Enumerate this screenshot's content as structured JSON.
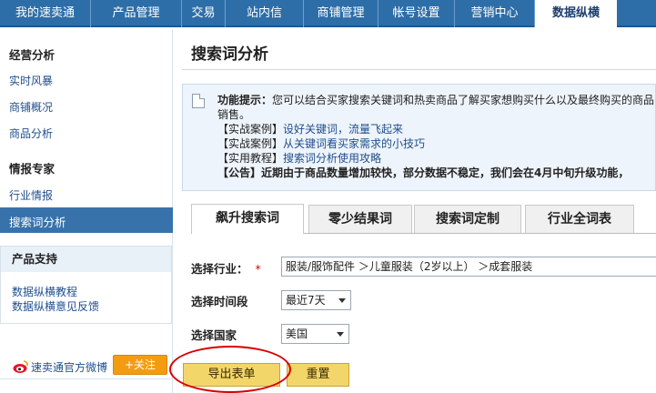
{
  "topnav": {
    "tabs": [
      "我的速卖通",
      "产品管理",
      "交易",
      "站内信",
      "商铺管理",
      "帐号设置",
      "营销中心",
      "数据纵横"
    ],
    "active_index": 7
  },
  "sidebar": {
    "section1_title": "经营分析",
    "section1_items": [
      "实时风暴",
      "商铺概况",
      "商品分析"
    ],
    "section2_title": "情报专家",
    "section2_items": [
      "行业情报",
      "搜索词分析"
    ],
    "active_item": "搜索词分析",
    "support": {
      "title": "产品支持",
      "links": [
        "数据纵横教程",
        "数据纵横意见反馈"
      ]
    },
    "weibo_label": "速卖通官方微博",
    "follow_label": "+关注"
  },
  "main": {
    "page_title": "搜索词分析",
    "notice": {
      "lead": "功能提示：",
      "text": "您可以结合买家搜索关键词和热卖商品了解买家想购买什么以及最终购买的商品",
      "text_cont": "销售。",
      "links": [
        {
          "prefix": "【实战案例】",
          "text": "设好关键词，流量飞起来"
        },
        {
          "prefix": "【实战案例】",
          "text": "从关键词看买家需求的小技巧"
        },
        {
          "prefix": "【实用教程】",
          "text": "搜索词分析使用攻略"
        }
      ],
      "announcement": "【公告】近期由于商品数量增加较快，部分数据不稳定，我们会在4月中旬升级功能，"
    },
    "tabs": [
      "飙升搜索词",
      "零少结果词",
      "搜索词定制",
      "行业全词表"
    ],
    "active_tab": 0,
    "form": {
      "industry_label": "选择行业：",
      "required_mark": "*",
      "industry_value": "服装/服饰配件 ＞儿童服装（2岁以上） ＞成套服装",
      "period_label": "选择时间段",
      "period_value": "最近7天",
      "country_label": "选择国家",
      "country_value": "美国"
    },
    "export_label": "导出表单",
    "reset_label": "重置"
  }
}
